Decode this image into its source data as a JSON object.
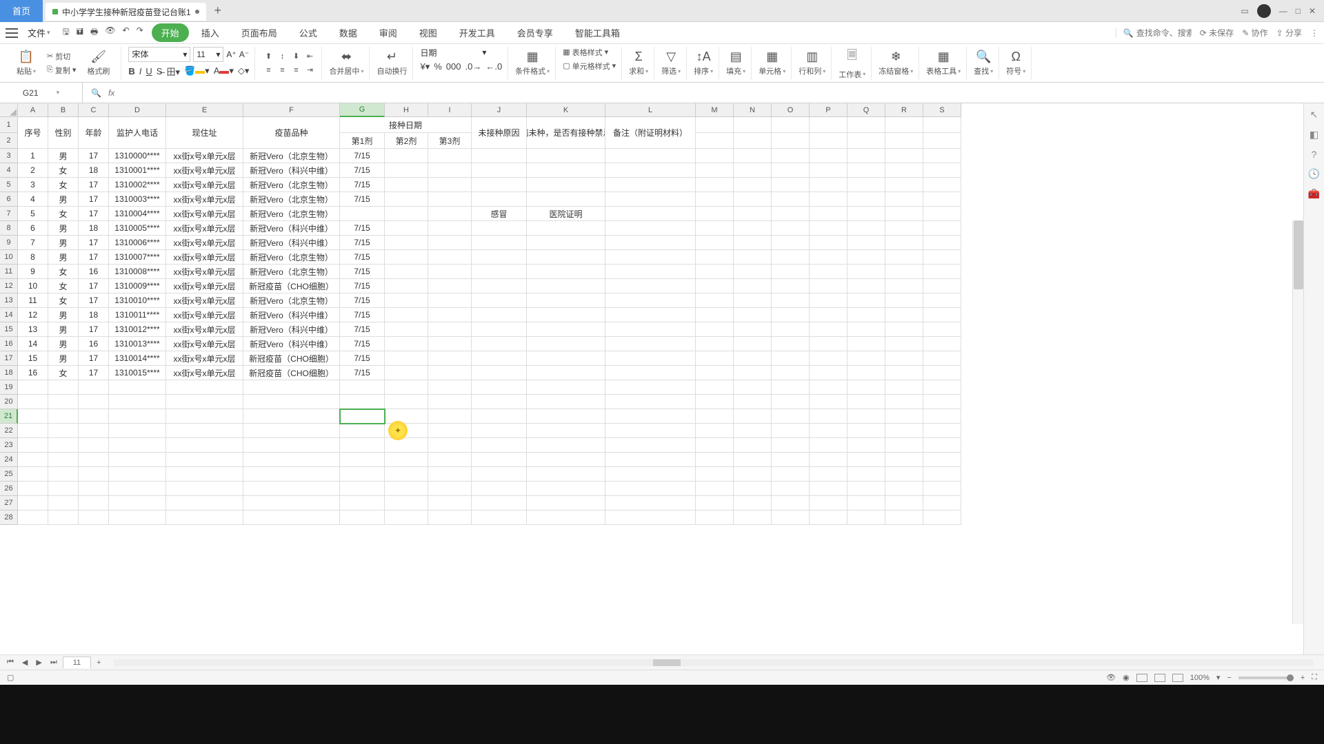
{
  "titlebar": {
    "home": "首页",
    "file_tab": "中小学学生接种新冠疫苗登记台账1",
    "unsaved": "未保存"
  },
  "menubar": {
    "file": "文件",
    "tabs": [
      "开始",
      "插入",
      "页面布局",
      "公式",
      "数据",
      "审阅",
      "视图",
      "开发工具",
      "会员专享",
      "智能工具箱"
    ],
    "search_ph": "查找命令、搜索模板",
    "collab": "协作",
    "share": "分享"
  },
  "ribbon": {
    "paste": "粘贴",
    "cut": "剪切",
    "copy": "复制",
    "fmt_painter": "格式刷",
    "font": "宋体",
    "size": "11",
    "merge": "合并居中",
    "wrap": "自动换行",
    "num_fmt": "日期",
    "cond_fmt": "条件格式",
    "table_style": "表格样式",
    "cell_style": "单元格样式",
    "sum": "求和",
    "filter": "筛选",
    "sort": "排序",
    "fill": "填充",
    "cells": "单元格",
    "rowcol": "行和列",
    "sheet": "工作表",
    "freeze": "冻结窗格",
    "table_tool": "表格工具",
    "find": "查找",
    "symbol": "符号"
  },
  "fx": {
    "name_box": "G21"
  },
  "columns": [
    "A",
    "B",
    "C",
    "D",
    "E",
    "F",
    "G",
    "H",
    "I",
    "J",
    "K",
    "L",
    "M",
    "N",
    "O",
    "P",
    "Q",
    "R",
    "S"
  ],
  "headers": {
    "A": "序号",
    "B": "性别",
    "C": "年龄",
    "D": "监护人电话",
    "E": "现住址",
    "F": "疫苗品种",
    "GH_I": "接种日期",
    "G": "第1剂",
    "H": "第2剂",
    "I": "第3剂",
    "J": "未接种原因",
    "K": "若因病未种，是否有接种禁忌证明",
    "L": "备注（附证明材料）"
  },
  "rows": [
    {
      "n": "1",
      "sex": "男",
      "age": "17",
      "tel": "1310000****",
      "addr": "xx街x号x单元x层",
      "vac": "新冠Vero（北京生物）",
      "d1": "7/15",
      "d2": "",
      "d3": "",
      "no": "",
      "cert": "",
      "note": ""
    },
    {
      "n": "2",
      "sex": "女",
      "age": "18",
      "tel": "1310001****",
      "addr": "xx街x号x单元x层",
      "vac": "新冠Vero（科兴中维）",
      "d1": "7/15",
      "d2": "",
      "d3": "",
      "no": "",
      "cert": "",
      "note": ""
    },
    {
      "n": "3",
      "sex": "女",
      "age": "17",
      "tel": "1310002****",
      "addr": "xx街x号x单元x层",
      "vac": "新冠Vero（北京生物）",
      "d1": "7/15",
      "d2": "",
      "d3": "",
      "no": "",
      "cert": "",
      "note": ""
    },
    {
      "n": "4",
      "sex": "男",
      "age": "17",
      "tel": "1310003****",
      "addr": "xx街x号x单元x层",
      "vac": "新冠Vero（北京生物）",
      "d1": "7/15",
      "d2": "",
      "d3": "",
      "no": "",
      "cert": "",
      "note": ""
    },
    {
      "n": "5",
      "sex": "女",
      "age": "17",
      "tel": "1310004****",
      "addr": "xx街x号x单元x层",
      "vac": "新冠Vero（北京生物）",
      "d1": "",
      "d2": "",
      "d3": "",
      "no": "感冒",
      "cert": "医院证明",
      "note": ""
    },
    {
      "n": "6",
      "sex": "男",
      "age": "18",
      "tel": "1310005****",
      "addr": "xx街x号x单元x层",
      "vac": "新冠Vero（科兴中维）",
      "d1": "7/15",
      "d2": "",
      "d3": "",
      "no": "",
      "cert": "",
      "note": ""
    },
    {
      "n": "7",
      "sex": "男",
      "age": "17",
      "tel": "1310006****",
      "addr": "xx街x号x单元x层",
      "vac": "新冠Vero（科兴中维）",
      "d1": "7/15",
      "d2": "",
      "d3": "",
      "no": "",
      "cert": "",
      "note": ""
    },
    {
      "n": "8",
      "sex": "男",
      "age": "17",
      "tel": "1310007****",
      "addr": "xx街x号x单元x层",
      "vac": "新冠Vero（北京生物）",
      "d1": "7/15",
      "d2": "",
      "d3": "",
      "no": "",
      "cert": "",
      "note": ""
    },
    {
      "n": "9",
      "sex": "女",
      "age": "16",
      "tel": "1310008****",
      "addr": "xx街x号x单元x层",
      "vac": "新冠Vero（北京生物）",
      "d1": "7/15",
      "d2": "",
      "d3": "",
      "no": "",
      "cert": "",
      "note": ""
    },
    {
      "n": "10",
      "sex": "女",
      "age": "17",
      "tel": "1310009****",
      "addr": "xx街x号x单元x层",
      "vac": "新冠疫苗（CHO细胞）",
      "d1": "7/15",
      "d2": "",
      "d3": "",
      "no": "",
      "cert": "",
      "note": ""
    },
    {
      "n": "11",
      "sex": "女",
      "age": "17",
      "tel": "1310010****",
      "addr": "xx街x号x单元x层",
      "vac": "新冠Vero（北京生物）",
      "d1": "7/15",
      "d2": "",
      "d3": "",
      "no": "",
      "cert": "",
      "note": ""
    },
    {
      "n": "12",
      "sex": "男",
      "age": "18",
      "tel": "1310011****",
      "addr": "xx街x号x单元x层",
      "vac": "新冠Vero（科兴中维）",
      "d1": "7/15",
      "d2": "",
      "d3": "",
      "no": "",
      "cert": "",
      "note": ""
    },
    {
      "n": "13",
      "sex": "男",
      "age": "17",
      "tel": "1310012****",
      "addr": "xx街x号x单元x层",
      "vac": "新冠Vero（科兴中维）",
      "d1": "7/15",
      "d2": "",
      "d3": "",
      "no": "",
      "cert": "",
      "note": ""
    },
    {
      "n": "14",
      "sex": "男",
      "age": "16",
      "tel": "1310013****",
      "addr": "xx街x号x单元x层",
      "vac": "新冠Vero（科兴中维）",
      "d1": "7/15",
      "d2": "",
      "d3": "",
      "no": "",
      "cert": "",
      "note": ""
    },
    {
      "n": "15",
      "sex": "男",
      "age": "17",
      "tel": "1310014****",
      "addr": "xx街x号x单元x层",
      "vac": "新冠疫苗（CHO细胞）",
      "d1": "7/15",
      "d2": "",
      "d3": "",
      "no": "",
      "cert": "",
      "note": ""
    },
    {
      "n": "16",
      "sex": "女",
      "age": "17",
      "tel": "1310015****",
      "addr": "xx街x号x单元x层",
      "vac": "新冠疫苗（CHO细胞）",
      "d1": "7/15",
      "d2": "",
      "d3": "",
      "no": "",
      "cert": "",
      "note": ""
    }
  ],
  "sheet_tab": "11",
  "zoom": "100%",
  "active_cell": "G21"
}
